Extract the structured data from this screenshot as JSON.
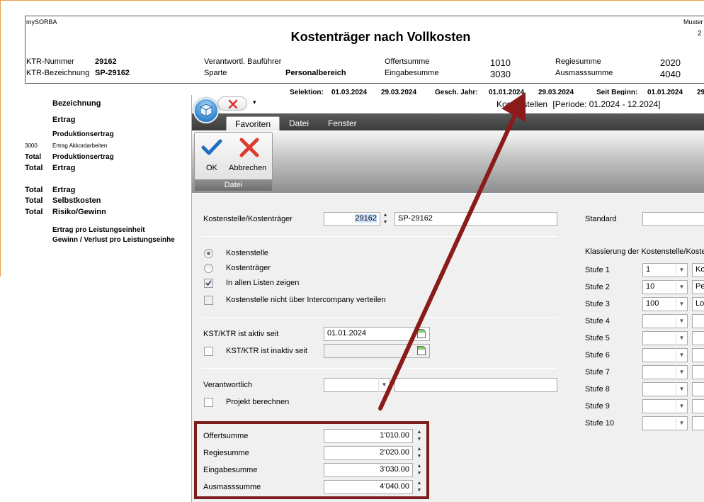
{
  "report": {
    "company": "mySORBA",
    "top_right": "Muster",
    "top_right_2": "2",
    "title": "Kostenträger nach Vollkosten",
    "header_fields": [
      {
        "label": "KTR-Nummer",
        "value": "29162"
      },
      {
        "label": "KTR-Bezeichnung",
        "value": "SP-29162"
      },
      {
        "label": "Verantwortl. Bauführer",
        "value": ""
      },
      {
        "label": "Sparte",
        "value": "Personalbereich"
      },
      {
        "label": "Offertsumme",
        "value": "1010"
      },
      {
        "label": "Eingabesumme",
        "value": "3030"
      },
      {
        "label": "Regiesumme",
        "value": "2020"
      },
      {
        "label": "Ausmasssumme",
        "value": "4040"
      }
    ],
    "selection_row": [
      "Selektion:",
      "01.03.2024",
      "29.03.2024",
      "Gesch. Jahr:",
      "01.01.2024",
      "29.03.2024",
      "Seit Beginn:",
      "01.01.2024",
      "29"
    ],
    "column_header": "Bezeichnung",
    "rows": [
      {
        "prefix": "",
        "label": "Ertrag",
        "style": "bold"
      },
      {
        "prefix": "",
        "label": "Produktionsertrag",
        "style": "bold-small"
      },
      {
        "prefix": "3000",
        "label": "Ertrag Akkordarbeiten",
        "style": "tiny"
      },
      {
        "prefix": "Total",
        "label": "Produktionsertrag",
        "style": "bold-small"
      },
      {
        "prefix": "Total",
        "label": "Ertrag",
        "style": "bold"
      },
      {
        "prefix": "Total",
        "label": "Ertrag",
        "style": "bold"
      },
      {
        "prefix": "Total",
        "label": "Selbstkosten",
        "style": "bold"
      },
      {
        "prefix": "Total",
        "label": "Risiko/Gewinn",
        "style": "bold"
      },
      {
        "prefix": "",
        "label": "Ertrag pro Leistungseinheit",
        "style": "bold-small"
      },
      {
        "prefix": "",
        "label": "Gewinn / Verlust pro Leistungseinhe",
        "style": "bold-small"
      }
    ]
  },
  "dialog": {
    "window_title": "Kostenstellen",
    "period": "[Periode: 01.2024 - 12.2024]",
    "qat_icon": "close-x-icon",
    "qat_more": "▾",
    "tabs": [
      "Favoriten",
      "Datei",
      "Fenster"
    ],
    "ribbon": {
      "ok_label": "OK",
      "cancel_label": "Abbrechen",
      "group_label": "Datei"
    },
    "form": {
      "kst_label": "Kostenstelle/Kostenträger",
      "kst_number": "29162",
      "kst_name": "SP-29162",
      "radio_kostenstelle": "Kostenstelle",
      "radio_kostentraeger": "Kostenträger",
      "chk_all_lists": "In allen Listen zeigen",
      "chk_intercompany": "Kostenstelle nicht über Intercompany verteilen",
      "active_since_label": "KST/KTR ist aktiv seit",
      "active_since_value": "01.01.2024",
      "inactive_since_label": "KST/KTR ist inaktiv seit",
      "inactive_since_value": "",
      "responsible_label": "Verantwortlich",
      "project_calc_label": "Projekt berechnen",
      "sums": [
        {
          "label": "Offertsumme",
          "value": "1'010.00"
        },
        {
          "label": "Regiesumme",
          "value": "2'020.00"
        },
        {
          "label": "Eingabesumme",
          "value": "3'030.00"
        },
        {
          "label": "Ausmasssumme",
          "value": "4'040.00"
        }
      ],
      "standard_label": "Standard",
      "classification_label": "Klassierung der Kostenstelle/Kosten",
      "stufen": [
        {
          "label": "Stufe 1",
          "value": "1",
          "text": "Kos"
        },
        {
          "label": "Stufe 2",
          "value": "10",
          "text": "Per"
        },
        {
          "label": "Stufe 3",
          "value": "100",
          "text": "Loh"
        },
        {
          "label": "Stufe 4",
          "value": "",
          "text": ""
        },
        {
          "label": "Stufe 5",
          "value": "",
          "text": ""
        },
        {
          "label": "Stufe 6",
          "value": "",
          "text": ""
        },
        {
          "label": "Stufe 7",
          "value": "",
          "text": ""
        },
        {
          "label": "Stufe 8",
          "value": "",
          "text": ""
        },
        {
          "label": "Stufe 9",
          "value": "",
          "text": ""
        },
        {
          "label": "Stufe 10",
          "value": "",
          "text": ""
        }
      ]
    }
  },
  "colors": {
    "highlight": "#7b1d1d",
    "arrow": "#8b1a1a",
    "ok_check": "#1f6fc0",
    "cancel_x": "#e03a2e"
  }
}
